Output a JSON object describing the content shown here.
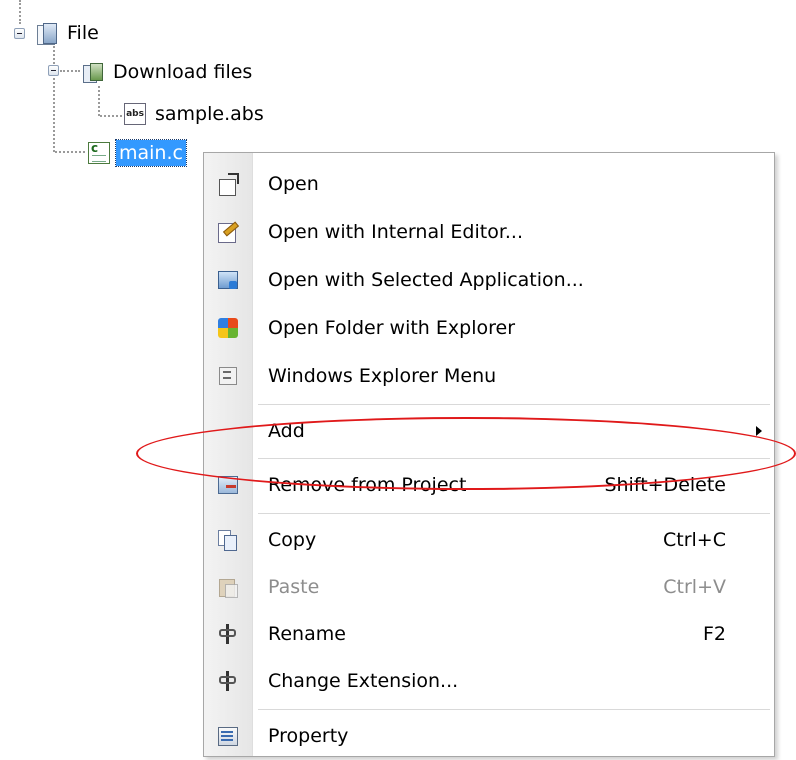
{
  "tree": {
    "root": {
      "label": "File",
      "icon": "file-folder-icon"
    },
    "download_files": {
      "label": "Download files",
      "icon": "download-files-icon"
    },
    "sample": {
      "label": "sample.abs",
      "icon": "abs-file-icon"
    },
    "main": {
      "label": "main.c",
      "icon": "c-source-file-icon",
      "selected": true
    }
  },
  "context_menu": {
    "items": [
      {
        "label": "Open",
        "icon": "open-icon",
        "shortcut": ""
      },
      {
        "label": "Open with Internal Editor...",
        "icon": "internal-editor-icon",
        "shortcut": ""
      },
      {
        "label": "Open with Selected Application...",
        "icon": "selected-application-icon",
        "shortcut": ""
      },
      {
        "label": "Open Folder with Explorer",
        "icon": "explorer-folder-icon",
        "shortcut": ""
      },
      {
        "label": "Windows Explorer Menu",
        "icon": "windows-explorer-menu-icon",
        "shortcut": ""
      },
      {
        "label": "Add",
        "icon": "",
        "shortcut": "",
        "has_submenu": true
      },
      {
        "label": "Remove from Project",
        "icon": "remove-from-project-icon",
        "shortcut": "Shift+Delete",
        "highlighted": true
      },
      {
        "label": "Copy",
        "icon": "copy-icon",
        "shortcut": "Ctrl+C"
      },
      {
        "label": "Paste",
        "icon": "paste-icon",
        "shortcut": "Ctrl+V",
        "disabled": true
      },
      {
        "label": "Rename",
        "icon": "rename-icon",
        "shortcut": "F2"
      },
      {
        "label": "Change Extension...",
        "icon": "change-extension-icon",
        "shortcut": ""
      },
      {
        "label": "Property",
        "icon": "property-icon",
        "shortcut": ""
      }
    ]
  },
  "colors": {
    "selection": "#3399ff",
    "highlight_ellipse": "#e0191a",
    "disabled_text": "#8d8d8d"
  }
}
